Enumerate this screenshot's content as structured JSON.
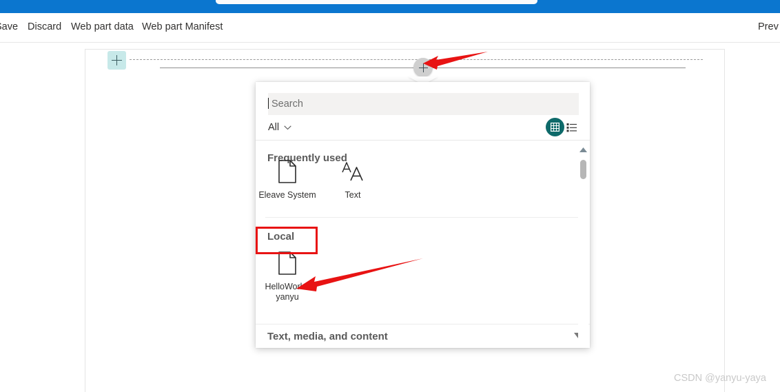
{
  "browser": {
    "omnibox_value": ""
  },
  "command_bar": {
    "items": [
      {
        "label": "Save",
        "name": "save"
      },
      {
        "label": "Discard",
        "name": "discard"
      },
      {
        "label": "Web part data",
        "name": "webpart-data"
      },
      {
        "label": "Web part Manifest",
        "name": "webpart-manifest"
      }
    ],
    "preview_label": "Prev"
  },
  "canvas": {
    "section_add_icon": "plus-icon",
    "webpart_add_icon": "plus-icon"
  },
  "panel": {
    "search": {
      "placeholder": "Search",
      "value": ""
    },
    "filter": {
      "selected": "All",
      "chevron_icon": "chevron-down-icon"
    },
    "view_toggle": {
      "grid_icon": "grid-view-icon",
      "list_icon": "list-view-icon",
      "selected": "grid",
      "selected_color": "#0e6a6a"
    },
    "groups": [
      {
        "heading": "Frequently used",
        "items": [
          {
            "label": "Eleave System",
            "icon": "document-icon"
          },
          {
            "label": "Text",
            "icon": "text-aa-icon"
          }
        ]
      },
      {
        "heading": "Local",
        "items": [
          {
            "label": "HelloWorld-yanyu",
            "icon": "document-icon"
          }
        ]
      },
      {
        "heading": "Text, media, and content",
        "items": []
      }
    ],
    "scrollbar": {
      "up_icon": "caret-up-icon",
      "down_icon": "caret-down-icon"
    }
  },
  "annotations": {
    "highlight_color": "#e81313",
    "box_target": "Local",
    "arrow_targets": [
      "webpart-add-button",
      "HelloWorld-yanyu"
    ]
  },
  "watermark": {
    "text": "CSDN @yanyu-yaya"
  }
}
